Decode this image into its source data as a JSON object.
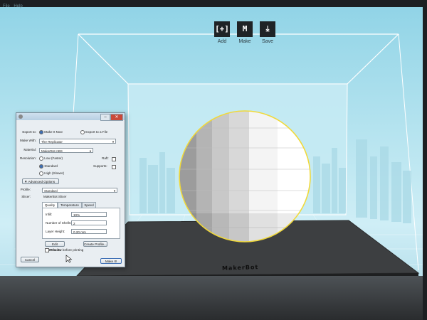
{
  "menu": {
    "items": [
      "File",
      "Help"
    ]
  },
  "toolbar": {
    "add": {
      "label": "Add",
      "glyph": "[+]",
      "icon": "add-icon"
    },
    "make": {
      "label": "Make",
      "glyph": "M",
      "icon": "makerbot-m-icon"
    },
    "save": {
      "label": "Save",
      "glyph": "⤓",
      "icon": "download-icon"
    }
  },
  "dialog": {
    "export_to_label": "Export to:",
    "make_it_now": "Make It Now",
    "export_to_file": "Export to a File",
    "make_with_label": "Make With:",
    "make_with_value": "The Replicator",
    "material_label": "Material:",
    "material_value": "MakerBot ABS",
    "resolution_label": "Resolution:",
    "res_low": "Low (Faster)",
    "res_standard": "Standard",
    "res_high": "High (Slower)",
    "raft_label": "Raft:",
    "supports_label": "Supports:",
    "advanced_options": "Advanced Options",
    "profile_label": "Profile:",
    "profile_value": "Standard",
    "slicer_label": "Slicer:",
    "slicer_value": "MakerBot Slicer",
    "tabs": [
      "Quality",
      "Temperature",
      "Speed"
    ],
    "infill_label": "Infill:",
    "infill_value": "10%",
    "shells_label": "Number of Shells:",
    "shells_value": "2",
    "layer_label": "Layer Height:",
    "layer_value": "0.20 mm",
    "edit_defaults": "Edit Defaults",
    "create_profile": "Create Profile...",
    "preview_label": "Preview before printing",
    "cancel": "Cancel",
    "make_it": "Make It!"
  },
  "platform_logo": "MakerBot",
  "colors": {
    "sky_blue": "#8fd3e6",
    "selection_outline": "#f1d93a",
    "platform_dark": "#3d3f41",
    "toolbar_button": "#1f2326"
  }
}
